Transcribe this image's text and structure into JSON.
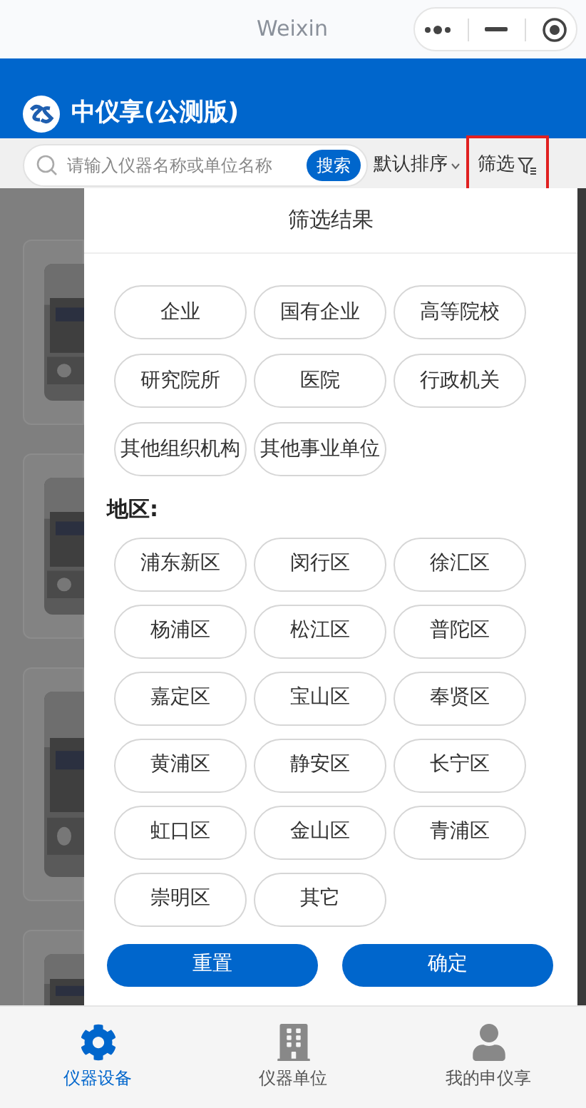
{
  "window": {
    "title": "Weixin"
  },
  "header": {
    "app_title": "中仪享(公测版)"
  },
  "search": {
    "placeholder": "请输入仪器名称或单位名称",
    "button": "搜索"
  },
  "sort": {
    "label": "默认排序"
  },
  "filter": {
    "label": "筛选",
    "highlighted": true
  },
  "panel": {
    "title": "筛选结果",
    "types": [
      {
        "label": "企业",
        "selected": false
      },
      {
        "label": "国有企业",
        "selected": false
      },
      {
        "label": "高等院校",
        "selected": false
      },
      {
        "label": "研究院所",
        "selected": false
      },
      {
        "label": "医院",
        "selected": false
      },
      {
        "label": "行政机关",
        "selected": false
      },
      {
        "label": "其他组织机构",
        "selected": false
      },
      {
        "label": "其他事业单位",
        "selected": false
      }
    ],
    "region_heading": "地区:",
    "regions": [
      {
        "label": "浦东新区",
        "selected": false
      },
      {
        "label": "闵行区",
        "selected": false
      },
      {
        "label": "徐汇区",
        "selected": false
      },
      {
        "label": "杨浦区",
        "selected": false
      },
      {
        "label": "松江区",
        "selected": false
      },
      {
        "label": "普陀区",
        "selected": false
      },
      {
        "label": "嘉定区",
        "selected": false
      },
      {
        "label": "宝山区",
        "selected": false
      },
      {
        "label": "奉贤区",
        "selected": false
      },
      {
        "label": "黄浦区",
        "selected": false
      },
      {
        "label": "静安区",
        "selected": false
      },
      {
        "label": "长宁区",
        "selected": false
      },
      {
        "label": "虹口区",
        "selected": false
      },
      {
        "label": "金山区",
        "selected": false
      },
      {
        "label": "青浦区",
        "selected": false
      },
      {
        "label": "崇明区",
        "selected": false
      },
      {
        "label": "其它",
        "selected": false
      }
    ],
    "buttons": [
      "重置",
      "确定"
    ]
  },
  "tabbar": [
    {
      "label": "仪器设备",
      "selected": true
    },
    {
      "label": "仪器单位",
      "selected": false
    },
    {
      "label": "我的申仪享",
      "selected": false
    }
  ]
}
